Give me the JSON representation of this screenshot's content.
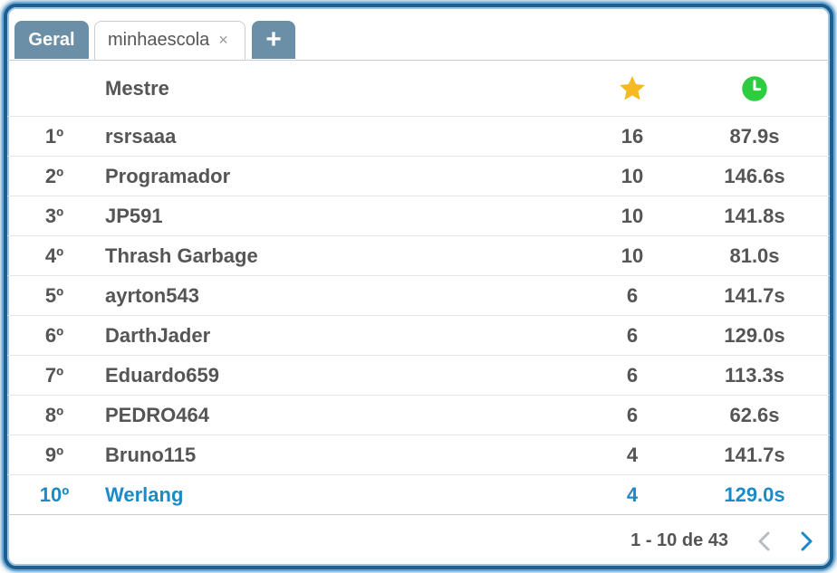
{
  "tabs": {
    "geral": "Geral",
    "school": "minhaescola",
    "close_glyph": "×",
    "add_glyph": "+"
  },
  "header": {
    "name_label": "Mestre",
    "score_icon": "star-icon",
    "time_icon": "clock-icon"
  },
  "rows": [
    {
      "rank": "1º",
      "name": "rsrsaaa",
      "score": "16",
      "time": "87.9s"
    },
    {
      "rank": "2º",
      "name": "Programador",
      "score": "10",
      "time": "146.6s"
    },
    {
      "rank": "3º",
      "name": "JP591",
      "score": "10",
      "time": "141.8s"
    },
    {
      "rank": "4º",
      "name": "Thrash Garbage",
      "score": "10",
      "time": "81.0s"
    },
    {
      "rank": "5º",
      "name": "ayrton543",
      "score": "6",
      "time": "141.7s"
    },
    {
      "rank": "6º",
      "name": "DarthJader",
      "score": "6",
      "time": "129.0s"
    },
    {
      "rank": "7º",
      "name": "Eduardo659",
      "score": "6",
      "time": "113.3s"
    },
    {
      "rank": "8º",
      "name": "PEDRO464",
      "score": "6",
      "time": "62.6s"
    },
    {
      "rank": "9º",
      "name": "Bruno115",
      "score": "4",
      "time": "141.7s"
    },
    {
      "rank": "10º",
      "name": "Werlang",
      "score": "4",
      "time": "129.0s"
    }
  ],
  "pagination": {
    "range": "1 - 10 de 43",
    "prev_icon": "chevron-left-icon",
    "next_icon": "chevron-right-icon"
  },
  "colors": {
    "tab_accent": "#6a8fa6",
    "highlight": "#1a8bc8",
    "star": "#f5b921",
    "clock": "#2ecc40",
    "frame": "#1f5f8f"
  }
}
